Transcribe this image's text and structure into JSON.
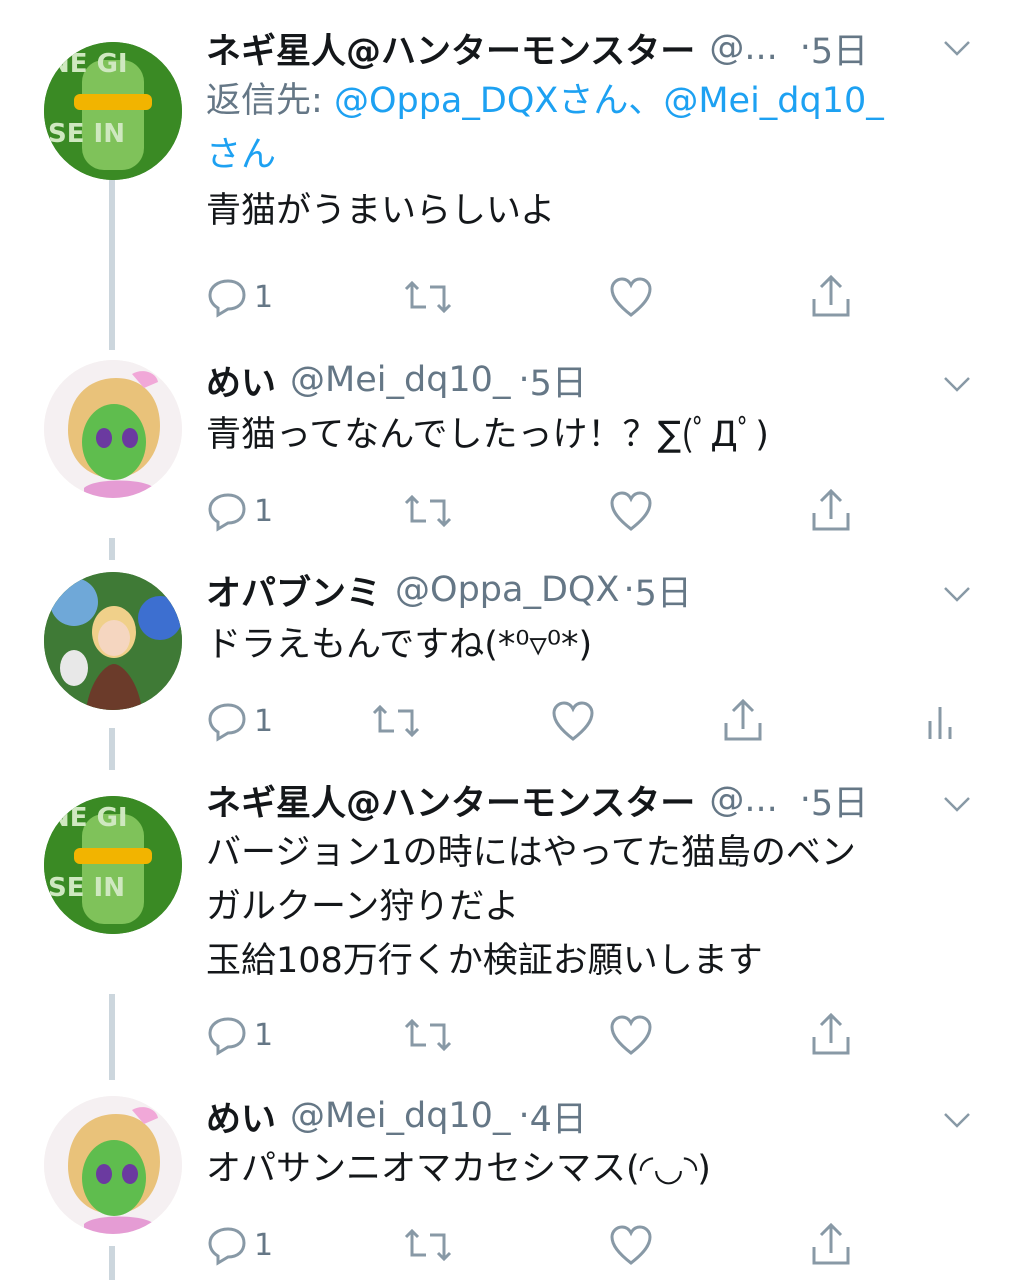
{
  "tweets": [
    {
      "name": "ネギ星人@ハンターモンスター",
      "handle": "@...",
      "time": "5日",
      "reply_label": "返信先:",
      "reply_mentions": "@Oppa_DQXさん、@Mei_dq10_",
      "reply_suffix": "さん",
      "text": "青猫がうまいらしいよ",
      "reply_count": "1",
      "avatar": "green-face-avatar"
    },
    {
      "name": "めい",
      "handle": "@Mei_dq10_",
      "time": "5日",
      "text": "青猫ってなんでしたっけ！？∑(ﾟДﾟ)",
      "reply_count": "1",
      "avatar": "girl-avatar"
    },
    {
      "name": "オパブンミ",
      "handle": "@Oppa_DQX",
      "time": "5日",
      "text": "ドラえもんですね(*⁰▿⁰*)",
      "reply_count": "1",
      "avatar": "blonde-character-avatar"
    },
    {
      "name": "ネギ星人@ハンターモンスター",
      "handle": "@...",
      "time": "5日",
      "text_lines": [
        "バージョン1の時にはやってた猫島のベン",
        "ガルクーン狩りだよ",
        "玉給108万行くか検証お願いします"
      ],
      "reply_count": "1",
      "avatar": "green-face-avatar"
    },
    {
      "name": "めい",
      "handle": "@Mei_dq10_",
      "time": "4日",
      "text": "オパサンニオマカセシマス(◜◡◝)",
      "reply_count": "1",
      "avatar": "girl-avatar"
    }
  ],
  "colors": {
    "link": "#1da1f2",
    "secondary": "#657786",
    "thread_line": "#ccd6dd"
  }
}
